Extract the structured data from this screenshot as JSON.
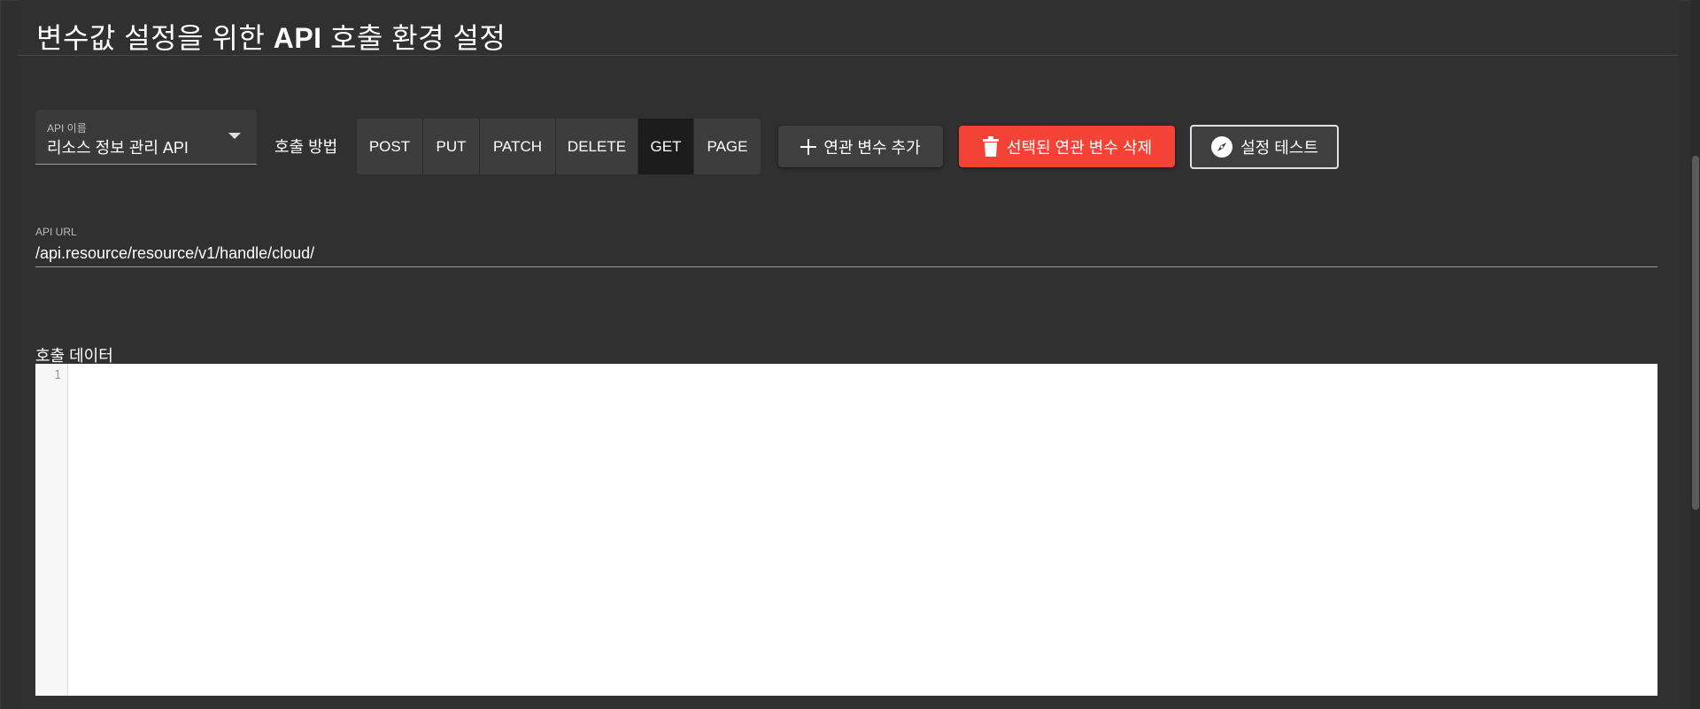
{
  "page": {
    "title_part1": "변수값 설정을 위한",
    "title_bold": "API",
    "title_part2": "호출 환경 설정"
  },
  "api_select": {
    "label": "API 이름",
    "value": "리소스 정보 관리 API"
  },
  "method": {
    "label": "호출 방법",
    "options": [
      "POST",
      "PUT",
      "PATCH",
      "DELETE",
      "GET",
      "PAGE"
    ],
    "selected": "GET"
  },
  "actions": {
    "add_label": "연관 변수 추가",
    "delete_label": "선택된 연관 변수 삭제",
    "test_label": "설정 테스트"
  },
  "url": {
    "label": "API URL",
    "value": "/api.resource/resource/v1/handle/cloud/"
  },
  "call_data": {
    "label": "호출 데이터",
    "line_numbers": [
      "1"
    ]
  },
  "icons": {
    "select_caret": "caret-down-icon",
    "add": "plus-icon",
    "delete": "trash-icon",
    "test": "compass-icon"
  },
  "colors": {
    "background": "#303030",
    "delete_button": "#f44336",
    "method_selected": "#1c1c1c",
    "method_default": "#3d3d3d"
  }
}
